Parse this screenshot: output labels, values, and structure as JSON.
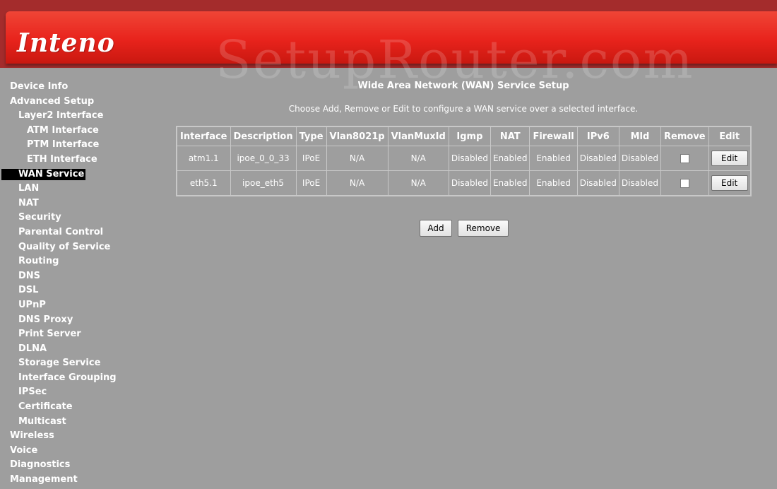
{
  "header": {
    "logo": "Inteno",
    "watermark": "SetupRouter.com"
  },
  "sidebar": {
    "items": [
      {
        "label": "Device Info",
        "level": 0
      },
      {
        "label": "Advanced Setup",
        "level": 0
      },
      {
        "label": "Layer2 Interface",
        "level": 1
      },
      {
        "label": "ATM Interface",
        "level": 2
      },
      {
        "label": "PTM Interface",
        "level": 2
      },
      {
        "label": "ETH Interface",
        "level": 2
      },
      {
        "label": "WAN Service",
        "level": 1,
        "active": true
      },
      {
        "label": "LAN",
        "level": 1
      },
      {
        "label": "NAT",
        "level": 1
      },
      {
        "label": "Security",
        "level": 1
      },
      {
        "label": "Parental Control",
        "level": 1
      },
      {
        "label": "Quality of Service",
        "level": 1
      },
      {
        "label": "Routing",
        "level": 1
      },
      {
        "label": "DNS",
        "level": 1
      },
      {
        "label": "DSL",
        "level": 1
      },
      {
        "label": "UPnP",
        "level": 1
      },
      {
        "label": "DNS Proxy",
        "level": 1
      },
      {
        "label": "Print Server",
        "level": 1
      },
      {
        "label": "DLNA",
        "level": 1
      },
      {
        "label": "Storage Service",
        "level": 1
      },
      {
        "label": "Interface Grouping",
        "level": 1
      },
      {
        "label": "IPSec",
        "level": 1
      },
      {
        "label": "Certificate",
        "level": 1
      },
      {
        "label": "Multicast",
        "level": 1
      },
      {
        "label": "Wireless",
        "level": 0
      },
      {
        "label": "Voice",
        "level": 0
      },
      {
        "label": "Diagnostics",
        "level": 0
      },
      {
        "label": "Management",
        "level": 0
      }
    ]
  },
  "main": {
    "title": "Wide Area Network (WAN) Service Setup",
    "description": "Choose Add, Remove or Edit to configure a WAN service over a selected interface.",
    "table": {
      "columns": [
        "Interface",
        "Description",
        "Type",
        "Vlan8021p",
        "VlanMuxId",
        "Igmp",
        "NAT",
        "Firewall",
        "IPv6",
        "Mld",
        "Remove",
        "Edit"
      ],
      "rows": [
        {
          "interface": "atm1.1",
          "description": "ipoe_0_0_33",
          "type": "IPoE",
          "vlan8021p": "N/A",
          "vlanmuxid": "N/A",
          "igmp": "Disabled",
          "nat": "Enabled",
          "firewall": "Enabled",
          "ipv6": "Disabled",
          "mld": "Disabled",
          "remove_checked": false,
          "edit_label": "Edit"
        },
        {
          "interface": "eth5.1",
          "description": "ipoe_eth5",
          "type": "IPoE",
          "vlan8021p": "N/A",
          "vlanmuxid": "N/A",
          "igmp": "Disabled",
          "nat": "Enabled",
          "firewall": "Enabled",
          "ipv6": "Disabled",
          "mld": "Disabled",
          "remove_checked": false,
          "edit_label": "Edit"
        }
      ]
    },
    "add_label": "Add",
    "remove_label": "Remove"
  }
}
